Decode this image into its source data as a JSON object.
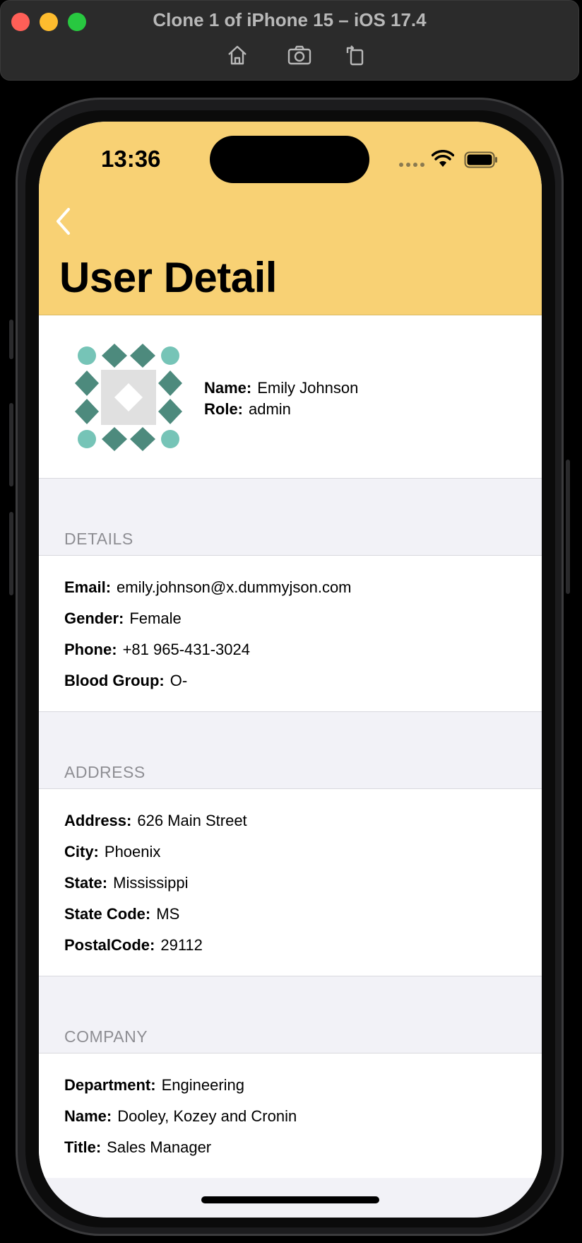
{
  "window": {
    "title": "Clone 1 of iPhone 15 – iOS 17.4",
    "toolbar": [
      "home-icon",
      "screenshot-icon",
      "rotate-icon"
    ]
  },
  "status_bar": {
    "time": "13:36"
  },
  "nav": {
    "title": "User Detail",
    "back_icon": "chevron-left-icon"
  },
  "colors": {
    "nav_bg": "#f8d174",
    "avatar_dark": "#4d8a7d",
    "avatar_light": "#76c4b7",
    "avatar_center": "#e0e0e0"
  },
  "profile": {
    "name_label": "Name:",
    "name_value": "Emily Johnson",
    "role_label": "Role:",
    "role_value": "admin"
  },
  "details": {
    "header": "DETAILS",
    "rows": [
      {
        "label": "Email:",
        "value": "emily.johnson@x.dummyjson.com"
      },
      {
        "label": "Gender:",
        "value": "Female"
      },
      {
        "label": "Phone:",
        "value": "+81 965-431-3024"
      },
      {
        "label": "Blood Group:",
        "value": "O-"
      }
    ]
  },
  "address": {
    "header": "ADDRESS",
    "rows": [
      {
        "label": "Address:",
        "value": "626 Main Street"
      },
      {
        "label": "City:",
        "value": "Phoenix"
      },
      {
        "label": "State:",
        "value": "Mississippi"
      },
      {
        "label": "State Code:",
        "value": "MS"
      },
      {
        "label": "PostalCode:",
        "value": "29112"
      }
    ]
  },
  "company": {
    "header": "COMPANY",
    "rows": [
      {
        "label": "Department:",
        "value": "Engineering"
      },
      {
        "label": "Name:",
        "value": "Dooley, Kozey and Cronin"
      },
      {
        "label": "Title:",
        "value": "Sales Manager"
      }
    ]
  }
}
